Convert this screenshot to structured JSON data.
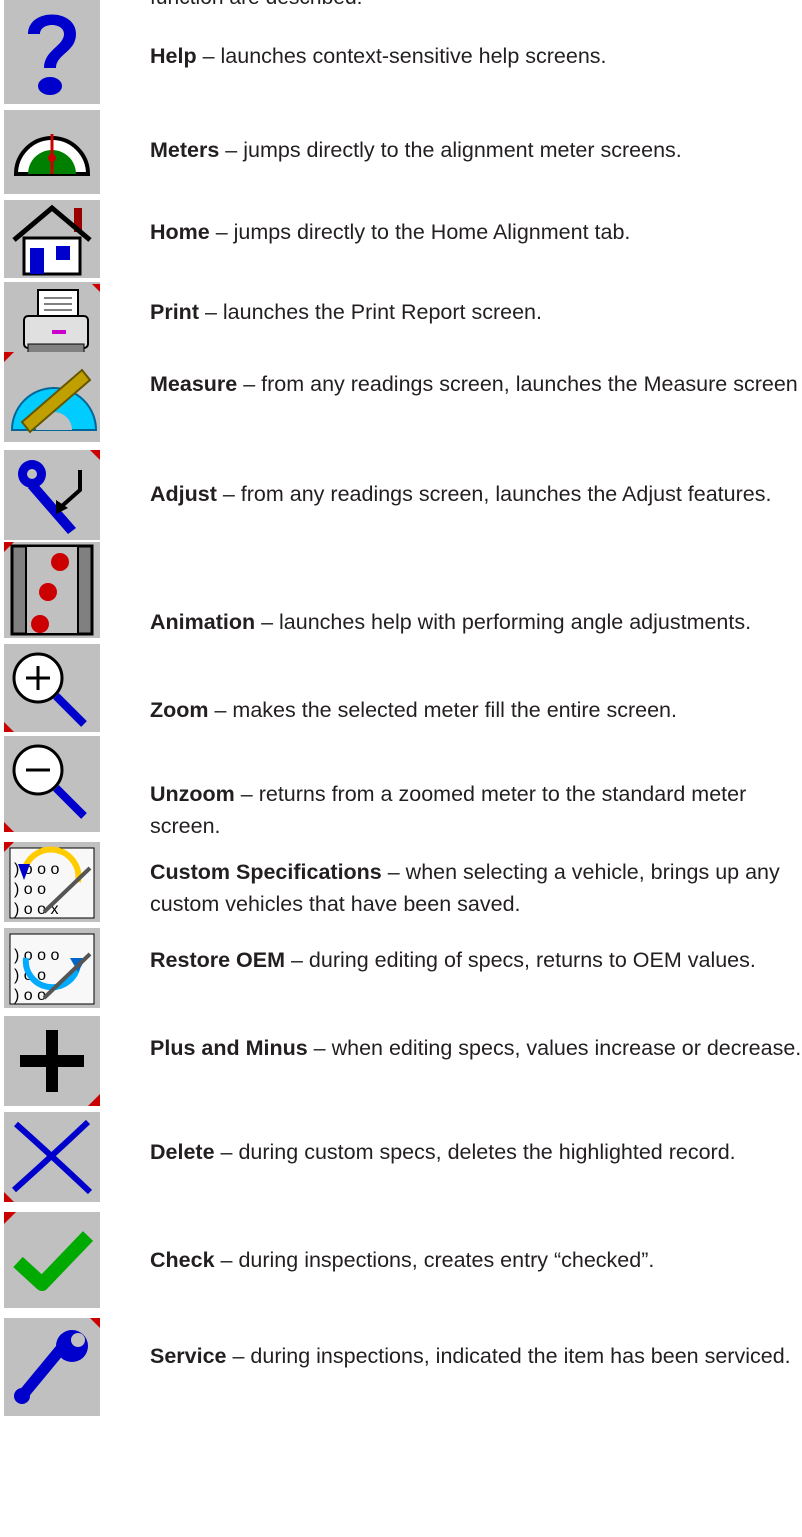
{
  "page": {
    "clipped_heading": "function are described:"
  },
  "entries": [
    {
      "icon": "help-icon",
      "term": "Help",
      "description": " – launches context-sensitive help screens."
    },
    {
      "icon": "meters-icon",
      "term": "Meters",
      "description": "  – jumps directly to the alignment meter screens."
    },
    {
      "icon": "home-icon",
      "term": "Home",
      "description": " – jumps directly to the Home Alignment tab."
    },
    {
      "icon": "print-icon",
      "term": "Print",
      "description": " – launches the Print Report screen."
    },
    {
      "icon": "measure-icon",
      "term": "Measure",
      "description": " – from any readings screen, launches the Measure screen"
    },
    {
      "icon": "adjust-icon",
      "term": "Adjust",
      "description": "  – from any readings screen, launches the Adjust features."
    },
    {
      "icon": "animation-icon",
      "term": "Animation",
      "description": " – launches help with performing angle adjustments."
    },
    {
      "icon": "zoom-icon",
      "term": "Zoom",
      "description": "  –  makes the selected meter fill the entire screen."
    },
    {
      "icon": "unzoom-icon",
      "term": "Unzoom",
      "description": "  –  returns from a zoomed meter to the standard meter screen."
    },
    {
      "icon": "custom-specifications-icon",
      "term": "Custom Specifications",
      "description": " – when selecting a vehicle, brings up any custom vehicles that have been saved."
    },
    {
      "icon": "restore-oem-icon",
      "term": "Restore OEM",
      "description": " – during editing of specs, returns to OEM values."
    },
    {
      "icon": "plus-icon",
      "term": "Plus and Minus",
      "description": " – when editing specs, values increase or decrease."
    },
    {
      "icon": "delete-icon",
      "term": "Delete",
      "description": "  – during custom specs, deletes the highlighted record."
    },
    {
      "icon": "check-icon",
      "term": "Check",
      "description": " – during inspections, creates entry “checked”."
    },
    {
      "icon": "service-icon",
      "term": "Service",
      "description": " – during inspections, indicated the item has been serviced."
    }
  ]
}
